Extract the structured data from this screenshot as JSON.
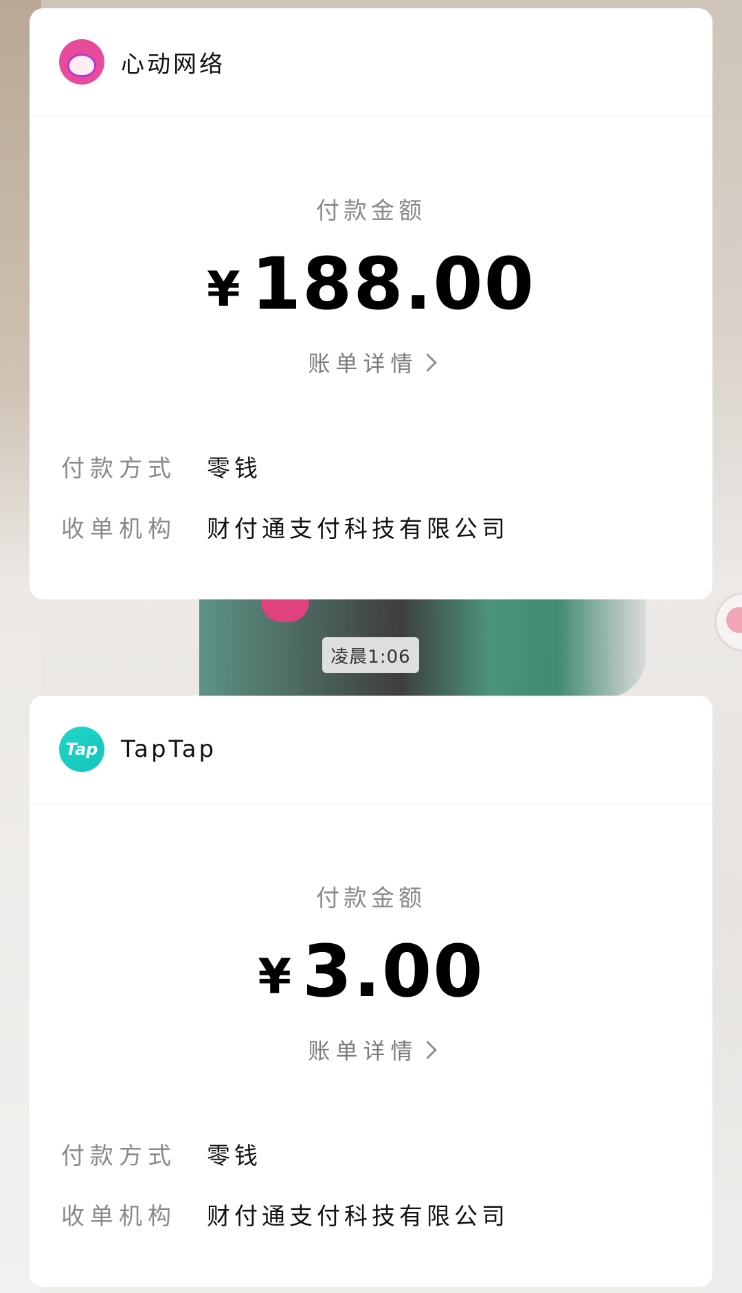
{
  "background": {
    "accent_green": "#2f7f66",
    "accent_pink": "#e0427e"
  },
  "cards": [
    {
      "merchant": {
        "name": "心动网络",
        "logo_icon": "anime-avatar-icon"
      },
      "amount_label": "付款金额",
      "currency": "¥",
      "amount": "188.00",
      "bill_link": "账单详情",
      "rows": [
        {
          "key": "付款方式",
          "value": "零钱"
        },
        {
          "key": "收单机构",
          "value": "财付通支付科技有限公司"
        }
      ]
    },
    {
      "merchant": {
        "name": "TapTap",
        "logo_icon": "taptap-logo-icon",
        "logo_text": "Tap"
      },
      "amount_label": "付款金额",
      "currency": "¥",
      "amount": "3.00",
      "bill_link": "账单详情",
      "rows": [
        {
          "key": "付款方式",
          "value": "零钱"
        },
        {
          "key": "收单机构",
          "value": "财付通支付科技有限公司"
        }
      ]
    }
  ],
  "timestamp": "凌晨1:06"
}
